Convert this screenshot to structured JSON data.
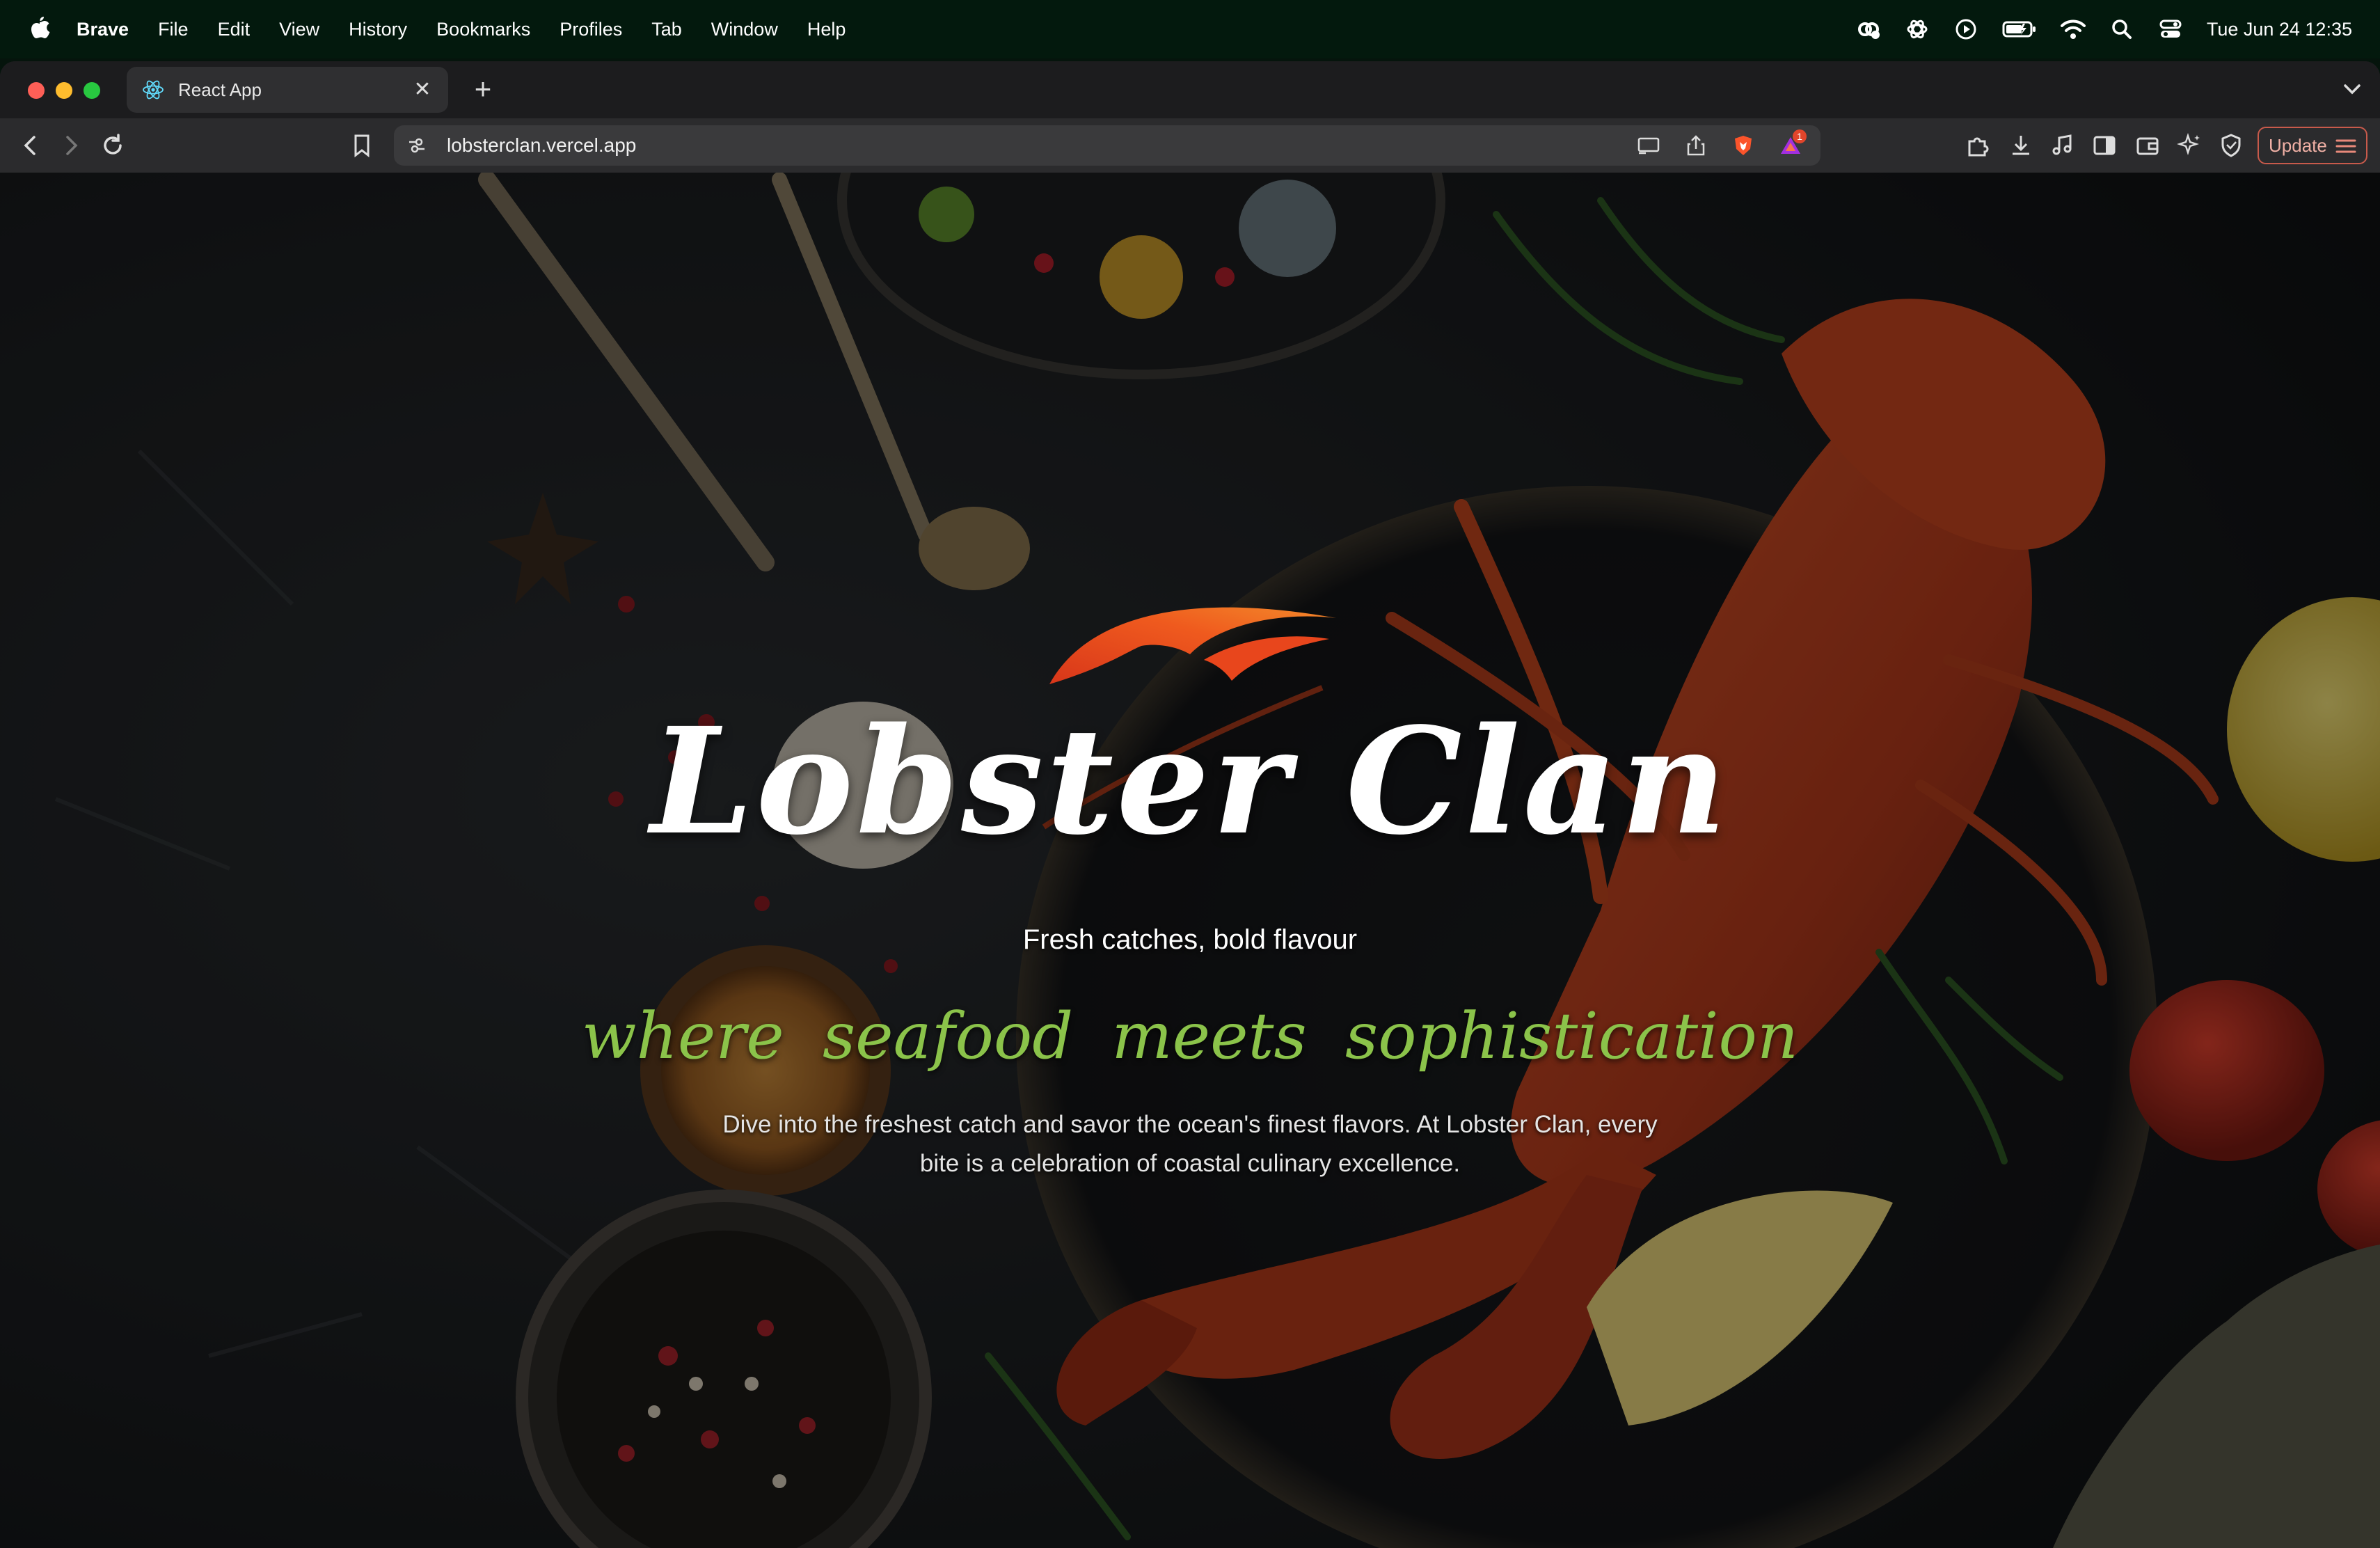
{
  "menubar": {
    "app_name": "Brave",
    "items": [
      "File",
      "Edit",
      "View",
      "History",
      "Bookmarks",
      "Profiles",
      "Tab",
      "Window",
      "Help"
    ],
    "clock": "Tue Jun 24  12:35",
    "status_icons": [
      "creative-cloud-icon",
      "openai-icon",
      "play-icon",
      "battery-icon",
      "wifi-icon",
      "search-icon",
      "control-center-icon"
    ]
  },
  "browser": {
    "tab": {
      "title": "React App",
      "favicon": "react-icon"
    },
    "url": "lobsterclan.vercel.app",
    "update_label": "Update",
    "notification_count": "1"
  },
  "hero": {
    "brand": "Lobster Clan",
    "tagline": "Fresh catches, bold flavour",
    "subtitle": "where seafood meets sophistication",
    "description": "Dive into the freshest catch and savor the ocean's finest flavors. At Lobster Clan, every bite is a celebration of coastal culinary excellence."
  },
  "colors": {
    "menubar_bg": "#03190d",
    "accent_green": "#8bc34a",
    "logo_orange": "#e8461c",
    "update_border": "#c85a4b"
  }
}
